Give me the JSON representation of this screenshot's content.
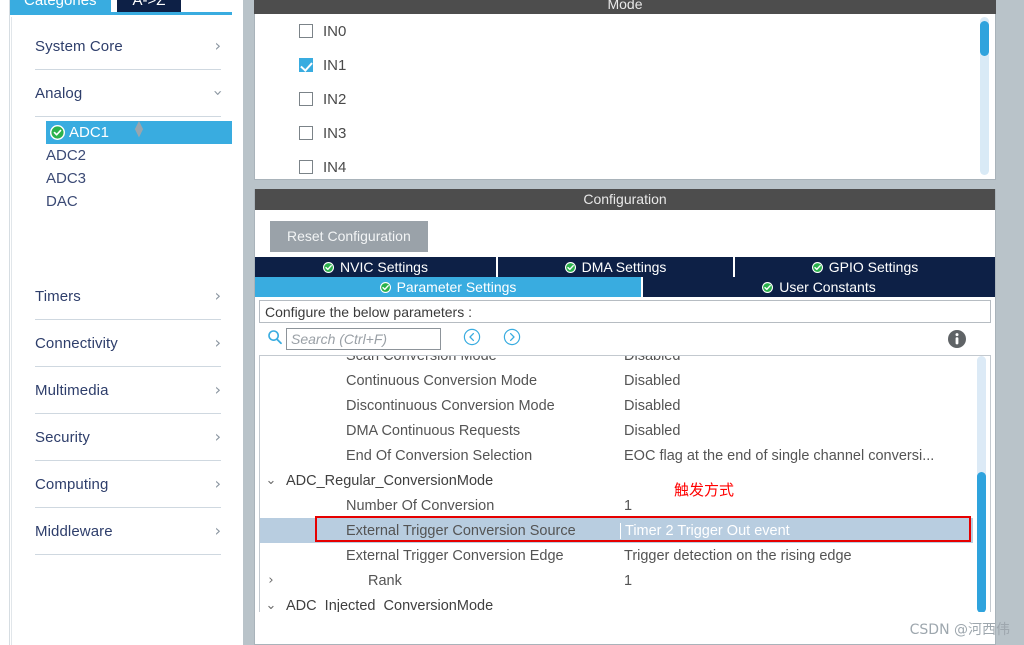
{
  "sidebar": {
    "tabs": [
      {
        "label": "Categories",
        "active": true
      },
      {
        "label": "A->Z",
        "active": false
      }
    ],
    "categories": [
      {
        "label": "System Core",
        "expanded": false
      },
      {
        "label": "Analog",
        "expanded": true
      },
      {
        "label": "Timers",
        "expanded": false
      },
      {
        "label": "Connectivity",
        "expanded": false
      },
      {
        "label": "Multimedia",
        "expanded": false
      },
      {
        "label": "Security",
        "expanded": false
      },
      {
        "label": "Computing",
        "expanded": false
      },
      {
        "label": "Middleware",
        "expanded": false
      }
    ],
    "analog_peripherals": [
      {
        "label": "ADC1",
        "selected": true,
        "configured": true
      },
      {
        "label": "ADC2",
        "selected": false,
        "configured": false
      },
      {
        "label": "ADC3",
        "selected": false,
        "configured": false
      },
      {
        "label": "DAC",
        "selected": false,
        "configured": false
      }
    ]
  },
  "mode_panel": {
    "title": "Mode",
    "channels": [
      {
        "label": "IN0",
        "checked": false
      },
      {
        "label": "IN1",
        "checked": true
      },
      {
        "label": "IN2",
        "checked": false
      },
      {
        "label": "IN3",
        "checked": false
      },
      {
        "label": "IN4",
        "checked": false
      }
    ]
  },
  "config_panel": {
    "title": "Configuration",
    "reset_label": "Reset Configuration",
    "tabs_row1": [
      {
        "label": "NVIC Settings",
        "active": false,
        "ok": true
      },
      {
        "label": "DMA Settings",
        "active": false,
        "ok": true
      },
      {
        "label": "GPIO Settings",
        "active": false,
        "ok": true
      }
    ],
    "tabs_row2": [
      {
        "label": "Parameter Settings",
        "active": true,
        "ok": true
      },
      {
        "label": "User Constants",
        "active": false,
        "ok": true
      }
    ],
    "configure_note": "Configure the below parameters :",
    "search": {
      "placeholder": "Search (Ctrl+F)",
      "value": "",
      "icon": "search-icon",
      "prev_icon": "prev-match-icon",
      "next_icon": "next-match-icon"
    },
    "info_icon": "info-icon"
  },
  "parameters": [
    {
      "kind": "child",
      "name": "Scan Conversion Mode",
      "value": "Disabled",
      "arrow": "",
      "selected": false
    },
    {
      "kind": "child",
      "name": "Continuous Conversion Mode",
      "value": "Disabled",
      "arrow": "",
      "selected": false
    },
    {
      "kind": "child",
      "name": "Discontinuous Conversion Mode",
      "value": "Disabled",
      "arrow": "",
      "selected": false
    },
    {
      "kind": "child",
      "name": "DMA Continuous Requests",
      "value": "Disabled",
      "arrow": "",
      "selected": false
    },
    {
      "kind": "child",
      "name": "End Of Conversion Selection",
      "value": "EOC flag at the end of single channel conversi...",
      "arrow": "",
      "selected": false
    },
    {
      "kind": "group",
      "name": "ADC_Regular_ConversionMode",
      "value": "",
      "arrow": "⌄",
      "selected": false
    },
    {
      "kind": "child",
      "name": "Number Of Conversion",
      "value": "1",
      "arrow": "",
      "selected": false
    },
    {
      "kind": "child",
      "name": "External Trigger Conversion Source",
      "value": "Timer 2 Trigger Out event",
      "arrow": "",
      "selected": true
    },
    {
      "kind": "child",
      "name": "External Trigger Conversion Edge",
      "value": "Trigger detection on the rising edge",
      "arrow": "",
      "selected": false
    },
    {
      "kind": "child-ind",
      "name": "Rank",
      "value": "1",
      "arrow": "›",
      "selected": false
    },
    {
      "kind": "group",
      "name": "ADC_Injected_ConversionMode",
      "value": "",
      "arrow": "⌄",
      "selected": false
    }
  ],
  "annotation": {
    "text": "触发方式",
    "color": "#ff0000"
  },
  "watermark": "CSDN @河西伟",
  "colors": {
    "accent_blue": "#39ace0",
    "tab_navy": "#0d2046",
    "header_gray": "#4d4d4d",
    "selection_row": "#b8cde0",
    "highlight_red": "#e60000",
    "ok_green": "#2bb24c"
  }
}
